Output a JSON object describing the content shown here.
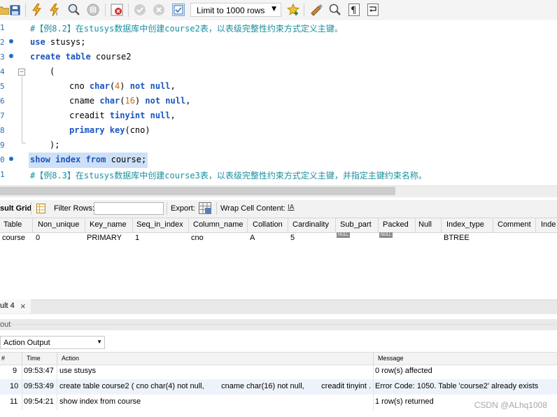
{
  "toolbar": {
    "icons": [
      "folder-icon",
      "save-icon",
      "execute-icon",
      "execute-current-icon",
      "explain-icon",
      "stop-icon",
      "toggle-error-icon",
      "commit-icon",
      "rollback-icon",
      "autocommit-icon",
      "add-snippet-icon",
      "beautify-icon",
      "find-icon",
      "invisible-chars-icon",
      "wrap-icon"
    ],
    "limit_label": "Limit to 1000 rows"
  },
  "editor": {
    "line_numbers": [
      "1",
      "2",
      "3",
      "4",
      "5",
      "6",
      "7",
      "8",
      "9",
      "0",
      "1"
    ]
  },
  "result_toolbar": {
    "result_grid_label": "sult Grid",
    "filter_rows_label": "Filter Rows:",
    "export_label": "Export:",
    "wrap_label": "Wrap Cell Content:",
    "wrap_icon": "IA"
  },
  "result_grid": {
    "columns": [
      "Table",
      "Non_unique",
      "Key_name",
      "Seq_in_index",
      "Column_name",
      "Collation",
      "Cardinality",
      "Sub_part",
      "Packed",
      "Null",
      "Index_type",
      "Comment",
      "Inde"
    ],
    "row": [
      "course",
      "0",
      "PRIMARY",
      "1",
      "cno",
      "A",
      "5",
      "NULL",
      "NULL",
      "",
      "BTREE",
      "",
      ""
    ]
  },
  "tab": {
    "label": "ult 4",
    "close": "×"
  },
  "output": {
    "pane_label": "out",
    "selector_value": "Action Output",
    "columns": [
      "#",
      "Time",
      "Action",
      "Message"
    ],
    "rows": [
      {
        "num": "9",
        "time": "09:53:47",
        "action": "use stusys",
        "message": "0 row(s) affected"
      },
      {
        "num": "10",
        "time": "09:53:49",
        "action": "create table course2 ( cno char(4) not null,        cname char(16) not null,        creadit tinyint ...",
        "message": "Error Code: 1050. Table 'course2' already exists"
      },
      {
        "num": "11",
        "time": "09:54:21",
        "action": "show index from course",
        "message": "1 row(s) returned"
      }
    ]
  },
  "watermark": "CSDN @ALhq1008"
}
